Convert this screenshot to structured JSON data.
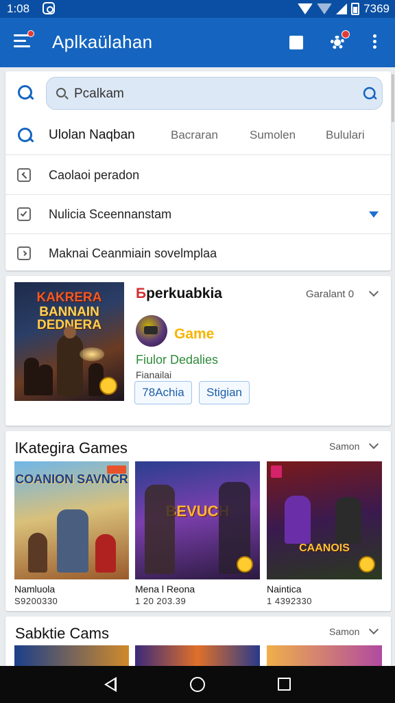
{
  "status_bar": {
    "time": "1:08",
    "right_text": "7369"
  },
  "app_bar": {
    "title": "Aplkaülahan"
  },
  "search": {
    "value": "Pcalkam",
    "tabs": [
      "Ulolan Naqban",
      "Bacraran",
      "Sumolen",
      "Bululari"
    ],
    "options": [
      "Caolaoi peradon",
      "Nulicia Sceennanstam",
      "Maknai Ceanmiain sovelmplaa"
    ]
  },
  "featured": {
    "name_prefix": "Б",
    "name_rest": "perkuabkia",
    "meta": "Garalant 0",
    "cover_lines": [
      "KAKRERA",
      "BANNAIN",
      "DEDNERA"
    ],
    "game_label": "Game",
    "subtitle": "Fiulor Dedalies",
    "caption": "Fianailai",
    "buttons": [
      "78Achia",
      "Stigian"
    ]
  },
  "categories": {
    "title": "lKategira Games",
    "link": "Samon",
    "tiles": [
      {
        "cover": "COANION SAVNCR",
        "name": "Namluola",
        "number": "S9200330"
      },
      {
        "cover": "BEVUCH",
        "name": "Mena l Reona",
        "number": "1 20 203.39"
      },
      {
        "cover": "CAANOIS",
        "name": "Naintica",
        "number": "1 4392330"
      }
    ]
  },
  "section2": {
    "title": "Sabktie Cams",
    "link": "Samon"
  },
  "colors": {
    "primary": "#1565c0",
    "status": "#0a4fa3",
    "accent": "#1e6fd0",
    "green": "#2e8b3a",
    "gold": "#f6b500"
  }
}
